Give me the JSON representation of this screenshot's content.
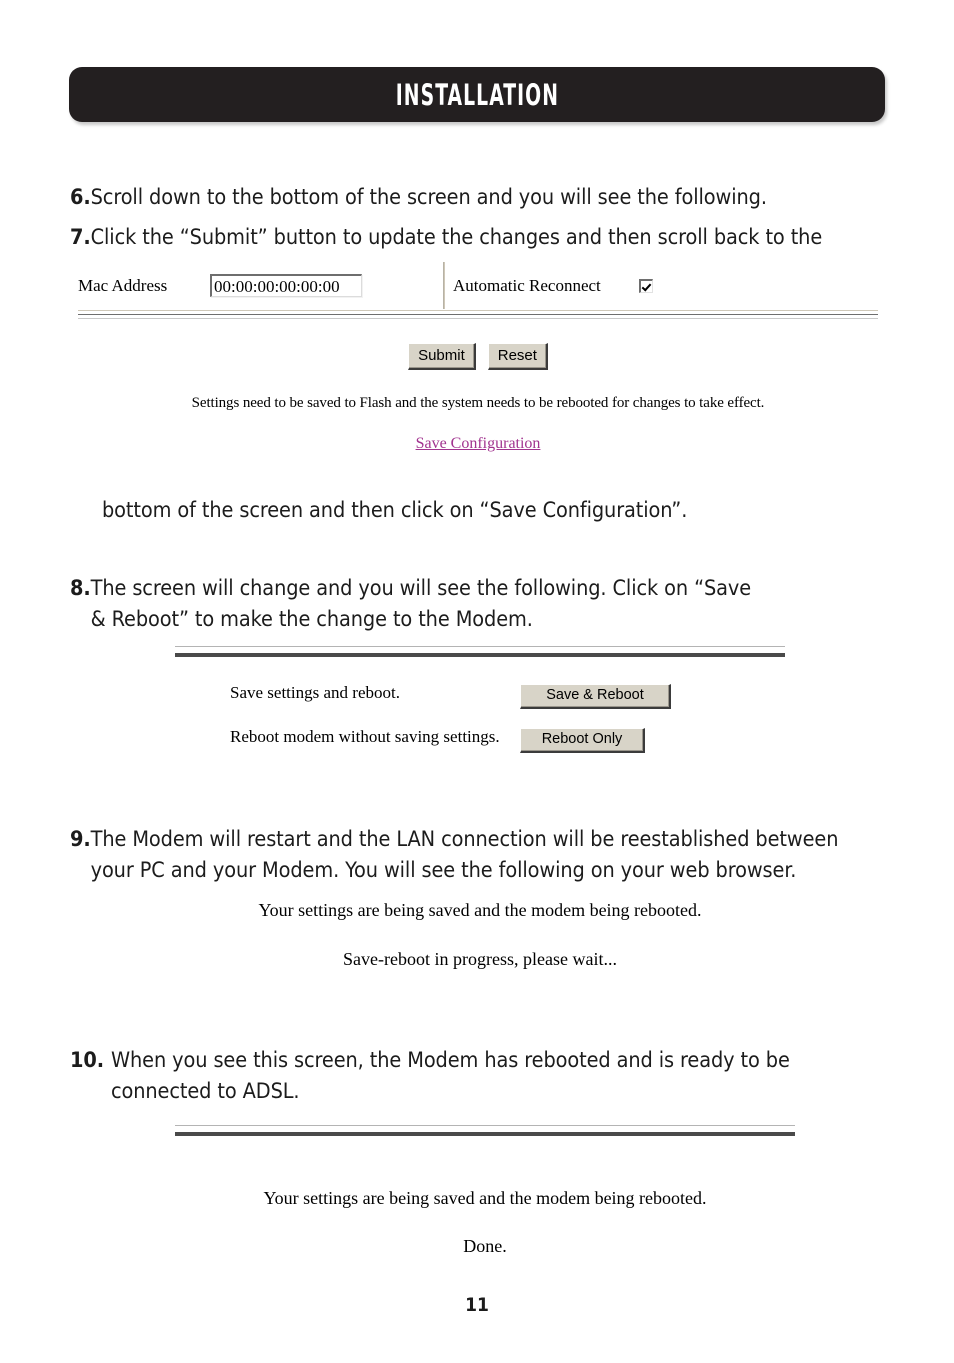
{
  "header": {
    "title": "INSTALLATION"
  },
  "steps": [
    {
      "number": "6.",
      "lines": [
        "Scroll down to the bottom of the screen and you will see the following."
      ]
    },
    {
      "number": "7.",
      "lines": [
        "Click the “Submit” button to update the changes and then scroll back to the"
      ]
    },
    {
      "number": "8.",
      "lines": [
        "The screen will change and you will see the following. Click on “Save",
        "& Reboot” to make the change to the Modem."
      ]
    },
    {
      "number": "9.",
      "lines": [
        "The Modem will restart and the LAN connection will be reestablished between",
        "your PC and your Modem. You will see the following on your web browser."
      ]
    },
    {
      "number": "10.",
      "lines": [
        "When you see this screen, the Modem has rebooted and is ready to be",
        "connected to ADSL."
      ]
    }
  ],
  "continuation_text": "bottom of the screen and then click on “Save Configuration”.",
  "screenshot_mac": {
    "mac_address_label": "Mac Address",
    "mac_address_value": "00:00:00:00:00:00",
    "automatic_reconnect_label": "Automatic Reconnect",
    "automatic_reconnect_checked": true,
    "submit_label": "Submit",
    "reset_label": "Reset",
    "flash_note": "Settings need to be saved to Flash and the system needs to be rebooted for changes to take effect.",
    "save_configuration_link": "Save Configuration",
    "link_color": "#a1338f"
  },
  "screenshot_reboot": {
    "save_settings_label": "Save settings and reboot.",
    "save_reboot_button": "Save & Reboot",
    "reboot_without_saving_label": "Reboot modem without saving settings.",
    "reboot_only_button": "Reboot Only"
  },
  "screenshot_saving": {
    "line1": "Your settings are being saved and the modem being rebooted.",
    "line2": "Save-reboot in progress, please wait..."
  },
  "screenshot_done": {
    "line1": "Your settings are being saved and the modem being rebooted.",
    "line2": "Done."
  },
  "page_number": "11",
  "colors": {
    "header_bg": "#231f20",
    "button_face": "#d8d4c8",
    "link": "#a1338f"
  }
}
